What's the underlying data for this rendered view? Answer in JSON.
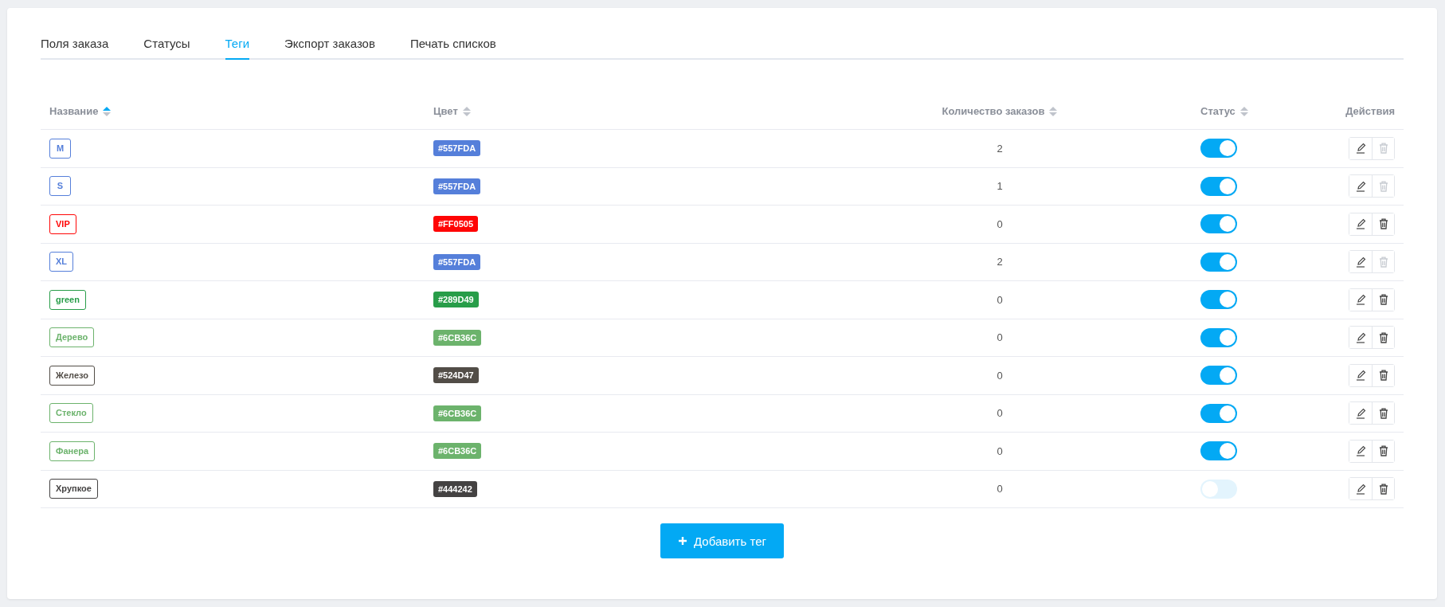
{
  "tabs": [
    {
      "label": "Поля заказа",
      "selected": false
    },
    {
      "label": "Статусы",
      "selected": false
    },
    {
      "label": "Теги",
      "selected": true
    },
    {
      "label": "Экспорт заказов",
      "selected": false
    },
    {
      "label": "Печать списков",
      "selected": false
    }
  ],
  "table": {
    "columns": [
      {
        "label": "Название",
        "sortable": true,
        "sorted": true
      },
      {
        "label": "Цвет",
        "sortable": true,
        "sorted": false
      },
      {
        "label": "Количество заказов",
        "sortable": true,
        "sorted": false
      },
      {
        "label": "Статус",
        "sortable": true,
        "sorted": false
      },
      {
        "label": "Действия",
        "sortable": false
      }
    ],
    "rows": [
      {
        "name": "M",
        "color": "#557fda",
        "color_label": "#557FDA",
        "orders": "2",
        "on": true,
        "delete_disabled": true
      },
      {
        "name": "S",
        "color": "#557fda",
        "color_label": "#557FDA",
        "orders": "1",
        "on": true,
        "delete_disabled": true
      },
      {
        "name": "VIP",
        "color": "#ff0505",
        "color_label": "#FF0505",
        "orders": "0",
        "on": true,
        "delete_disabled": false
      },
      {
        "name": "XL",
        "color": "#557fda",
        "color_label": "#557FDA",
        "orders": "2",
        "on": true,
        "delete_disabled": true
      },
      {
        "name": "green",
        "color": "#289d49",
        "color_label": "#289D49",
        "orders": "0",
        "on": true,
        "delete_disabled": false
      },
      {
        "name": "Дерево",
        "color": "#6cb36c",
        "color_label": "#6CB36C",
        "orders": "0",
        "on": true,
        "delete_disabled": false
      },
      {
        "name": "Железо",
        "color": "#524d47",
        "color_label": "#524D47",
        "orders": "0",
        "on": true,
        "delete_disabled": false
      },
      {
        "name": "Стекло",
        "color": "#6cb36c",
        "color_label": "#6CB36C",
        "orders": "0",
        "on": true,
        "delete_disabled": false
      },
      {
        "name": "Фанера",
        "color": "#6cb36c",
        "color_label": "#6CB36C",
        "orders": "0",
        "on": true,
        "delete_disabled": false
      },
      {
        "name": "Хрупкое",
        "color": "#444242",
        "color_label": "#444242",
        "orders": "0",
        "on": false,
        "delete_disabled": false
      }
    ]
  },
  "add_button": {
    "label": "Добавить тег"
  }
}
